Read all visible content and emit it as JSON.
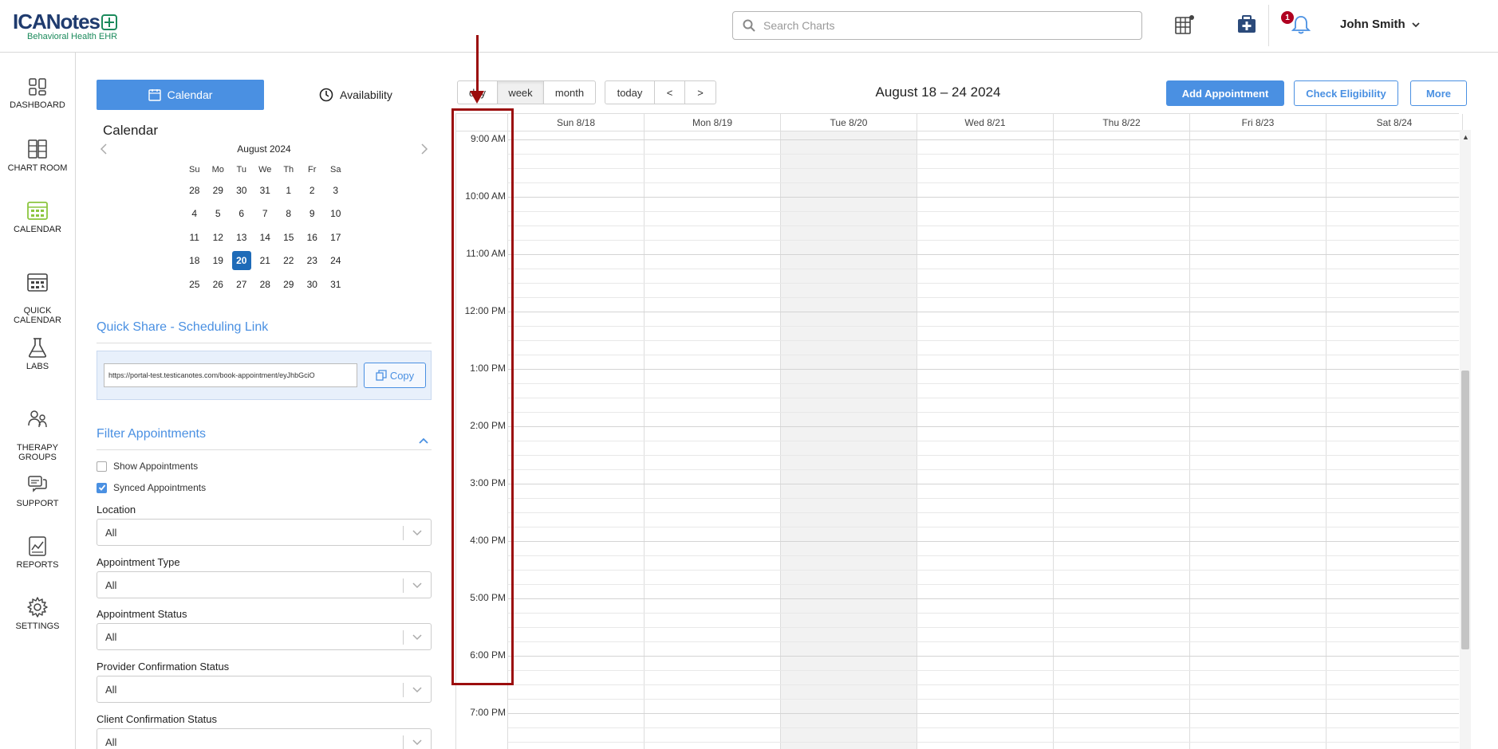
{
  "app": {
    "logo_main": "ICANotes",
    "logo_sub": "Behavioral Health EHR"
  },
  "header": {
    "search_placeholder": "Search Charts",
    "notification_count": "1",
    "user_name": "John Smith"
  },
  "nav": {
    "items": [
      {
        "label": "DASHBOARD",
        "icon": "dashboard-icon"
      },
      {
        "label": "CHART ROOM",
        "icon": "chart-room-icon"
      },
      {
        "label": "CALENDAR",
        "icon": "calendar-icon"
      },
      {
        "label": "QUICK\nCALENDAR",
        "icon": "quick-calendar-icon"
      },
      {
        "label": "LABS",
        "icon": "flask-icon"
      },
      {
        "label": "THERAPY\nGROUPS",
        "icon": "group-icon"
      },
      {
        "label": "SUPPORT",
        "icon": "chat-icon"
      },
      {
        "label": "REPORTS",
        "icon": "report-icon"
      },
      {
        "label": "SETTINGS",
        "icon": "gear-icon"
      }
    ],
    "accent_color": "#8cc63f"
  },
  "side": {
    "tab_calendar": "Calendar",
    "tab_availability": "Availability",
    "title": "Calendar",
    "mini_cal": {
      "month": "August 2024",
      "prev": "<",
      "next": ">",
      "weekdays": [
        "Su",
        "Mo",
        "Tu",
        "We",
        "Th",
        "Fr",
        "Sa"
      ],
      "weeks": [
        [
          "28",
          "29",
          "30",
          "31",
          "1",
          "2",
          "3"
        ],
        [
          "4",
          "5",
          "6",
          "7",
          "8",
          "9",
          "10"
        ],
        [
          "11",
          "12",
          "13",
          "14",
          "15",
          "16",
          "17"
        ],
        [
          "18",
          "19",
          "20",
          "21",
          "22",
          "23",
          "24"
        ],
        [
          "25",
          "26",
          "27",
          "28",
          "29",
          "30",
          "31"
        ]
      ],
      "today": "20"
    },
    "quick_share_title": "Quick Share - Scheduling Link",
    "share_url": "https://portal-test.testicanotes.com/book-appointment/eyJhbGciO",
    "copy_label": "Copy",
    "filter_title": "Filter Appointments",
    "show_appointments": "Show Appointments",
    "synced_appointments": "Synced Appointments",
    "filters": [
      {
        "label": "Location",
        "value": "All"
      },
      {
        "label": "Appointment Type",
        "value": "All"
      },
      {
        "label": "Appointment Status",
        "value": "All"
      },
      {
        "label": "Provider Confirmation Status",
        "value": "All"
      },
      {
        "label": "Client Confirmation Status",
        "value": "All"
      }
    ]
  },
  "calendar": {
    "view_day": "day",
    "view_week": "week",
    "view_month": "month",
    "today": "today",
    "prev": "<",
    "next": ">",
    "week_title": "August 18 – 24 2024",
    "add_appointment": "Add Appointment",
    "check_eligibility": "Check Eligibility",
    "more": "More",
    "days": [
      "Sun 8/18",
      "Mon 8/19",
      "Tue 8/20",
      "Wed 8/21",
      "Thu 8/22",
      "Fri 8/23",
      "Sat 8/24"
    ],
    "times": [
      "9:00 AM",
      "10:00 AM",
      "11:00 AM",
      "12:00 PM",
      "1:00 PM",
      "2:00 PM",
      "3:00 PM",
      "4:00 PM",
      "5:00 PM",
      "6:00 PM",
      "7:00 PM"
    ],
    "today_color": "#f2f2f2"
  },
  "colors": {
    "primary": "#4a90e2",
    "annotation": "#9b0d0d"
  }
}
